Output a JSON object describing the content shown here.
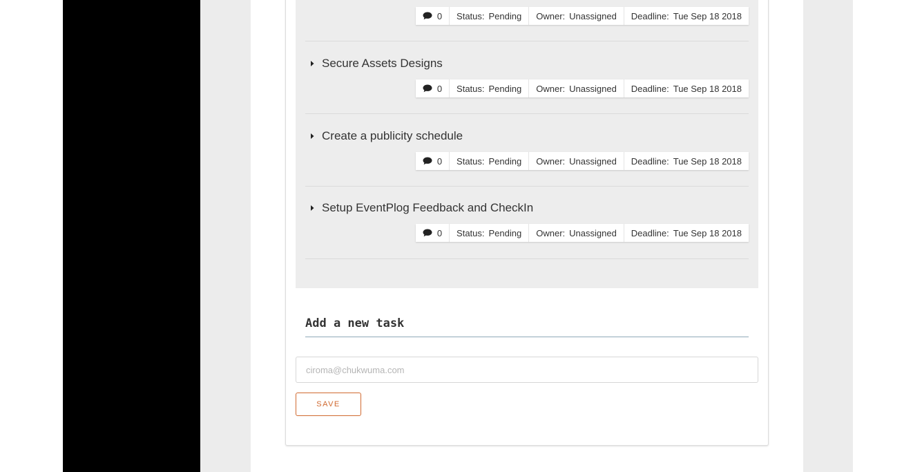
{
  "tasks": [
    {
      "title": "",
      "comments": "0",
      "status_label": "Status:",
      "status": "Pending",
      "owner_label": "Owner:",
      "owner": "Unassigned",
      "deadline_label": "Deadline:",
      "deadline": "Tue Sep 18 2018"
    },
    {
      "title": "Secure Assets Designs",
      "comments": "0",
      "status_label": "Status:",
      "status": "Pending",
      "owner_label": "Owner:",
      "owner": "Unassigned",
      "deadline_label": "Deadline:",
      "deadline": "Tue Sep 18 2018"
    },
    {
      "title": "Create a publicity schedule",
      "comments": "0",
      "status_label": "Status:",
      "status": "Pending",
      "owner_label": "Owner:",
      "owner": "Unassigned",
      "deadline_label": "Deadline:",
      "deadline": "Tue Sep 18 2018"
    },
    {
      "title": "Setup EventPlog Feedback and CheckIn",
      "comments": "0",
      "status_label": "Status:",
      "status": "Pending",
      "owner_label": "Owner:",
      "owner": "Unassigned",
      "deadline_label": "Deadline:",
      "deadline": "Tue Sep 18 2018"
    }
  ],
  "new_task": {
    "heading": "Add a new task",
    "email_placeholder": "ciroma@chukwuma.com",
    "save_label": "SAVE"
  },
  "icons": {
    "expand": "caret-right-icon",
    "comment": "comment-icon"
  },
  "colors": {
    "accent": "#d0692f",
    "underline": "#8fa9b8",
    "sidebar": "#000000",
    "task_list_bg": "#ededed"
  }
}
